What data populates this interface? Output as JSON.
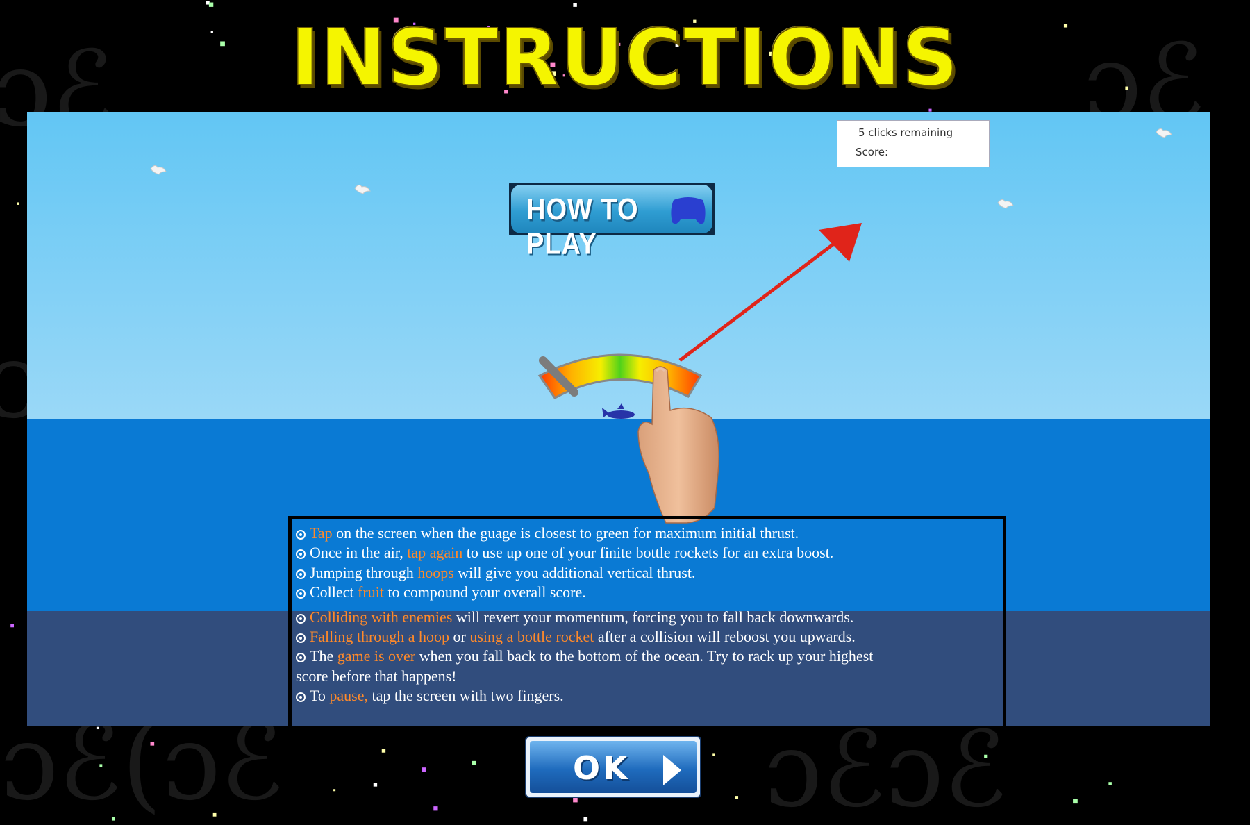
{
  "header": {
    "title": "INSTRUCTIONS"
  },
  "hud": {
    "clicks_remaining": "5 clicks remaining",
    "score_label": "Score:"
  },
  "how_to_play": {
    "label": "HOW TO PLAY",
    "icon": "gamepad-icon"
  },
  "instructions": [
    {
      "parts": [
        {
          "t": "Tap",
          "h": true
        },
        {
          "t": " on the screen when the guage is closest to green for maximum initial thrust.",
          "h": false
        }
      ]
    },
    {
      "parts": [
        {
          "t": "Once in the air, ",
          "h": false
        },
        {
          "t": "tap again",
          "h": true
        },
        {
          "t": " to use up one of your finite bottle rockets for an extra boost.",
          "h": false
        }
      ]
    },
    {
      "parts": [
        {
          "t": "Jumping through ",
          "h": false
        },
        {
          "t": "hoops",
          "h": true
        },
        {
          "t": " will give you additional vertical thrust.",
          "h": false
        }
      ]
    },
    {
      "parts": [
        {
          "t": "Collect ",
          "h": false
        },
        {
          "t": "fruit",
          "h": true
        },
        {
          "t": " to compound your overall score.",
          "h": false
        }
      ]
    },
    {
      "parts": [
        {
          "t": "Colliding with enemies",
          "h": true
        },
        {
          "t": " will revert your momentum, forcing you to fall back downwards.",
          "h": false
        }
      ]
    },
    {
      "parts": [
        {
          "t": "Falling through a hoop",
          "h": true
        },
        {
          "t": " or ",
          "h": false
        },
        {
          "t": "using a bottle rocket",
          "h": true
        },
        {
          "t": " after a collision will reboost you upwards.",
          "h": false
        }
      ]
    },
    {
      "parts": [
        {
          "t": "The ",
          "h": false
        },
        {
          "t": "game is over",
          "h": true
        },
        {
          "t": " when you fall back to the bottom of the ocean. Try to rack up your highest",
          "h": false
        }
      ],
      "cont": "score before that happens!"
    },
    {
      "parts": [
        {
          "t": "To ",
          "h": false
        },
        {
          "t": "pause,",
          "h": true
        },
        {
          "t": " tap the screen with two fingers.",
          "h": false
        }
      ]
    }
  ],
  "ok_button": {
    "label": "OK",
    "icon": "play-arrow-icon"
  },
  "colors": {
    "title": "#f5f500",
    "highlight": "#ff8a2a",
    "sky": "#62c6f4",
    "sea": "#0a7ad4",
    "deep_sea": "#314d7d",
    "arrow": "#e0241a"
  },
  "icons": [
    "bird-icon",
    "gauge-icon",
    "pointing-hand-icon",
    "arrow-icon",
    "fish-icon",
    "gamepad-icon",
    "play-arrow-icon"
  ]
}
